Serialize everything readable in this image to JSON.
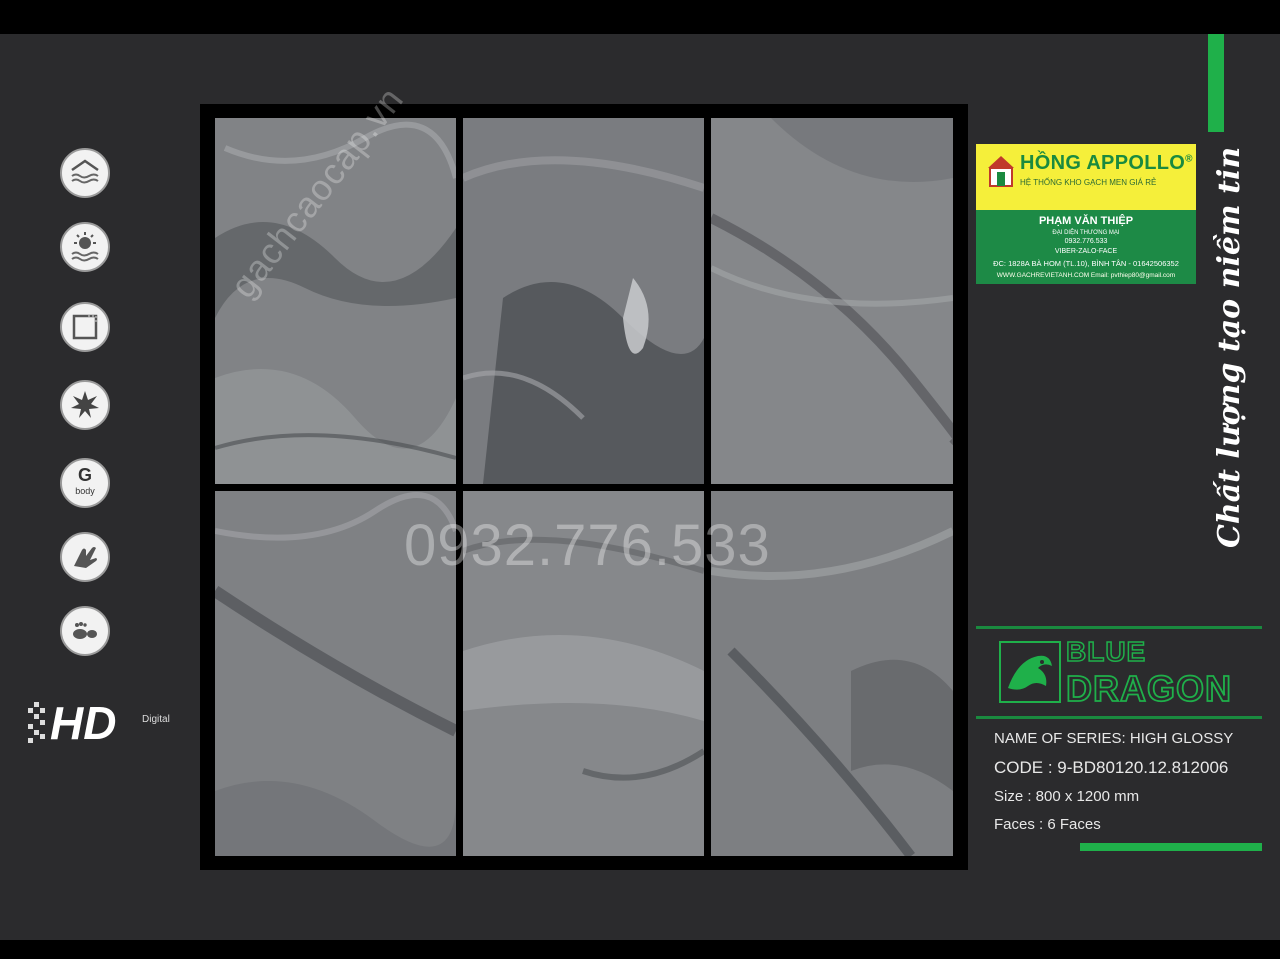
{
  "features": [
    {
      "icon": "roof-wave-icon"
    },
    {
      "icon": "sun-icon"
    },
    {
      "icon": "square-edge-icon"
    },
    {
      "icon": "star-burst-icon"
    },
    {
      "icon": "g-body-icon",
      "letter": "G",
      "sub": "body"
    },
    {
      "icon": "hand-icon"
    },
    {
      "icon": "foot-icon"
    }
  ],
  "hd": {
    "main": "HD",
    "sub": "Digital"
  },
  "watermark": {
    "site": "gachcaocap.vn",
    "phone": "0932.776.533"
  },
  "card": {
    "brand": "HỒNG APPOLLO",
    "reg": "®",
    "tagline": "HỆ THỐNG KHO GẠCH MEN GIÁ RẺ",
    "name": "PHẠM VĂN THIỆP",
    "role": "ĐẠI DIỆN THƯƠNG MẠI",
    "phone": "0932.776.533",
    "social": "VIBER-ZALO-FACE",
    "address": "ĐC: 1828A BÀ HOM (TL.10), BÌNH TÂN - 01642506352",
    "web": "WWW.GACHREVIETANH.COM  Email: pvthiep80@gmail.com"
  },
  "slogan": "Chất lượng tạo niềm tin",
  "brand": {
    "line1": "BLUE",
    "line2": "DRAGON"
  },
  "product": {
    "series": "NAME OF SERIES:  HIGH GLOSSY",
    "code": "CODE  :  9-BD80120.12.812006",
    "size": "Size    :  800 x 1200 mm",
    "faces": "Faces  :  6 Faces"
  },
  "colors": {
    "accent": "#1fb04a",
    "background": "#2b2b2d",
    "card": "#1d8a46",
    "card_top": "#f5ef3a"
  }
}
